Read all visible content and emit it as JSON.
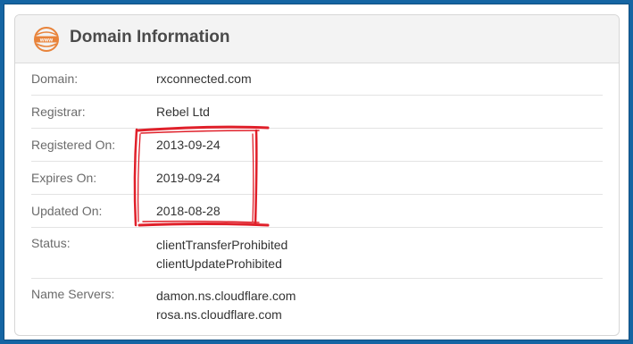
{
  "panel": {
    "title": "Domain Information",
    "icon_text": "www",
    "accent_color": "#e8833a"
  },
  "rows": [
    {
      "label": "Domain:",
      "values": [
        "rxconnected.com"
      ]
    },
    {
      "label": "Registrar:",
      "values": [
        "Rebel Ltd"
      ]
    },
    {
      "label": "Registered On:",
      "values": [
        "2013-09-24"
      ]
    },
    {
      "label": "Expires On:",
      "values": [
        "2019-09-24"
      ]
    },
    {
      "label": "Updated On:",
      "values": [
        "2018-08-28"
      ]
    },
    {
      "label": "Status:",
      "values": [
        "clientTransferProhibited",
        "clientUpdateProhibited"
      ]
    },
    {
      "label": "Name Servers:",
      "values": [
        "damon.ns.cloudflare.com",
        "rosa.ns.cloudflare.com"
      ]
    }
  ],
  "annotation": {
    "color": "#e0202a",
    "shape": "hand-drawn-box"
  }
}
